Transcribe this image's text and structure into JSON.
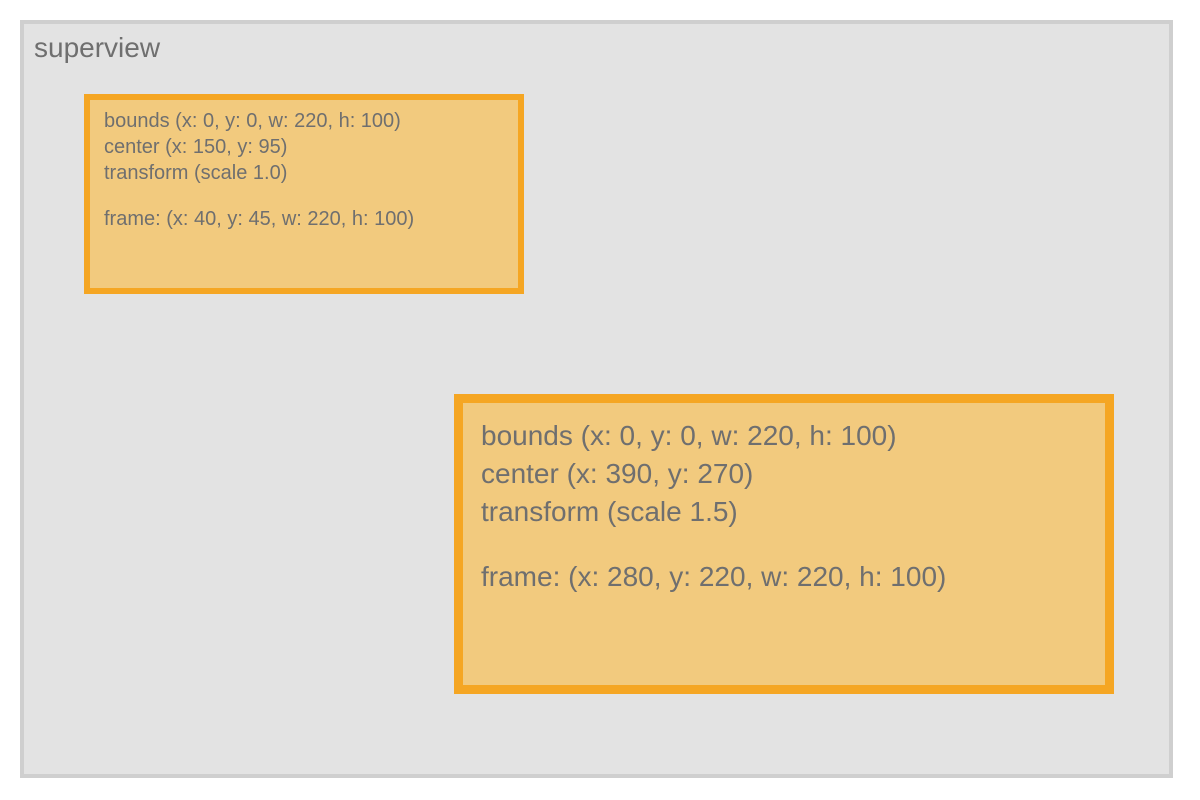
{
  "superview": {
    "label": "superview"
  },
  "views": [
    {
      "bounds": "bounds (x: 0, y: 0, w: 220, h: 100)",
      "center": "center (x: 150, y: 95)",
      "transform": "transform (scale 1.0)",
      "frame": "frame: (x: 40, y: 45, w: 220, h: 100)"
    },
    {
      "bounds": "bounds (x: 0, y: 0, w: 220, h: 100)",
      "center": "center (x: 390, y: 270)",
      "transform": "transform (scale 1.5)",
      "frame": "frame: (x: 280, y: 220, w: 220, h: 100)"
    }
  ]
}
